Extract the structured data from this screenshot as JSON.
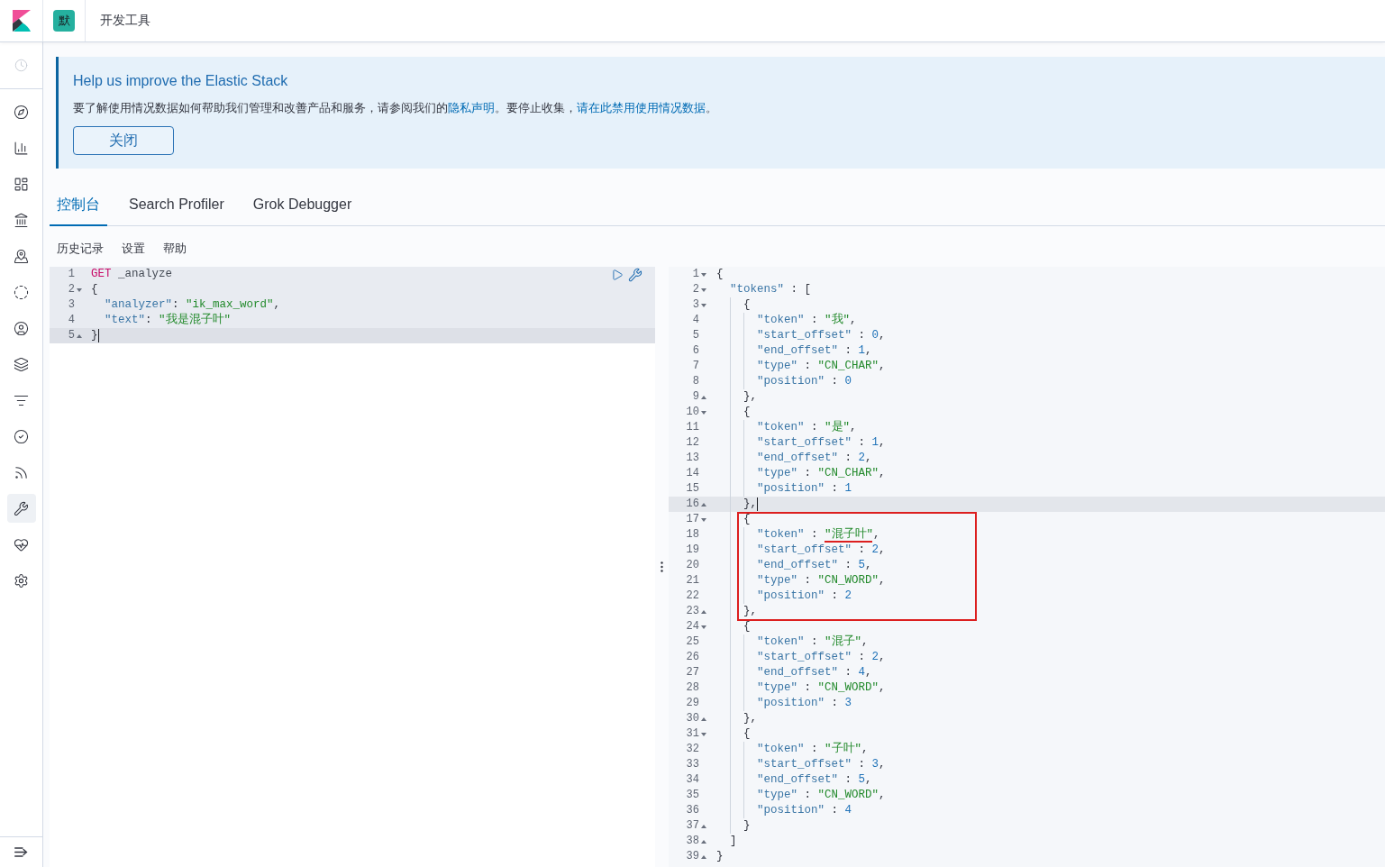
{
  "header": {
    "space_initial": "默",
    "title": "开发工具"
  },
  "sidebar": {
    "items": [
      {
        "kind": "compass",
        "selected": false
      },
      {
        "kind": "bar-chart",
        "selected": false
      },
      {
        "kind": "dashboard",
        "selected": false
      },
      {
        "kind": "building",
        "selected": false
      },
      {
        "kind": "map-pin",
        "selected": false
      },
      {
        "kind": "dashed-circle",
        "selected": false
      },
      {
        "kind": "user-circle",
        "selected": false
      },
      {
        "kind": "layers",
        "selected": false
      },
      {
        "kind": "filter",
        "selected": false
      },
      {
        "kind": "check-circle",
        "selected": false
      },
      {
        "kind": "signal",
        "selected": false
      },
      {
        "kind": "wrench",
        "selected": true
      },
      {
        "kind": "heart-pulse",
        "selected": false
      },
      {
        "kind": "gear",
        "selected": false
      }
    ]
  },
  "notice": {
    "title": "Help us improve the Elastic Stack",
    "body": [
      {
        "kind": "text",
        "text": "要了解使用情况数据如何帮助我们管理和改善产品和服务，请参阅我们的"
      },
      {
        "kind": "link",
        "text": "隐私声明"
      },
      {
        "kind": "text",
        "text": "。要停止收集，"
      },
      {
        "kind": "link",
        "text": "请在此禁用使用情况数据"
      },
      {
        "kind": "text",
        "text": "。"
      }
    ],
    "button": "关闭"
  },
  "tabs": [
    {
      "label": "控制台",
      "selected": true
    },
    {
      "label": "Search Profiler",
      "selected": false
    },
    {
      "label": "Grok Debugger",
      "selected": false
    }
  ],
  "toolbar": [
    "历史记录",
    "设置",
    "帮助"
  ],
  "request_editor": {
    "request_selected": true,
    "lines": [
      {
        "number": "1",
        "kind": "plain",
        "code": "GET _analyze",
        "active": false
      },
      {
        "number": "2",
        "kind": "fold-start",
        "code": "{",
        "active": false
      },
      {
        "number": "3",
        "kind": "plain",
        "code": "  \"analyzer\": \"ik_max_word\",",
        "active": false
      },
      {
        "number": "4",
        "kind": "plain",
        "code": "  \"text\": \"我是混子叶\"",
        "active": false
      },
      {
        "number": "5",
        "kind": "fold-end",
        "code": "}",
        "active": true
      }
    ]
  },
  "response_viewer": {
    "blocks": [
      {
        "kind": "plain",
        "lines": [
          {
            "number": "1",
            "kind": "fold-start",
            "code": "{",
            "active": false,
            "underlined": false
          },
          {
            "number": "2",
            "kind": "fold-start",
            "code": "  \"tokens\" : [",
            "active": false,
            "underlined": false
          },
          {
            "number": "3",
            "kind": "fold-start",
            "code": "    {",
            "active": false,
            "underlined": false
          },
          {
            "number": "4",
            "kind": "plain",
            "code": "      \"token\" : \"我\",",
            "active": false,
            "underlined": false
          },
          {
            "number": "5",
            "kind": "plain",
            "code": "      \"start_offset\" : 0,",
            "active": false,
            "underlined": false
          },
          {
            "number": "6",
            "kind": "plain",
            "code": "      \"end_offset\" : 1,",
            "active": false,
            "underlined": false
          },
          {
            "number": "7",
            "kind": "plain",
            "code": "      \"type\" : \"CN_CHAR\",",
            "active": false,
            "underlined": false
          },
          {
            "number": "8",
            "kind": "plain",
            "code": "      \"position\" : 0",
            "active": false,
            "underlined": false
          },
          {
            "number": "9",
            "kind": "fold-end",
            "code": "    },",
            "active": false,
            "underlined": false
          },
          {
            "number": "10",
            "kind": "fold-start",
            "code": "    {",
            "active": false,
            "underlined": false
          },
          {
            "number": "11",
            "kind": "plain",
            "code": "      \"token\" : \"是\",",
            "active": false,
            "underlined": false
          },
          {
            "number": "12",
            "kind": "plain",
            "code": "      \"start_offset\" : 1,",
            "active": false,
            "underlined": false
          },
          {
            "number": "13",
            "kind": "plain",
            "code": "      \"end_offset\" : 2,",
            "active": false,
            "underlined": false
          },
          {
            "number": "14",
            "kind": "plain",
            "code": "      \"type\" : \"CN_CHAR\",",
            "active": false,
            "underlined": false
          },
          {
            "number": "15",
            "kind": "plain",
            "code": "      \"position\" : 1",
            "active": false,
            "underlined": false
          },
          {
            "number": "16",
            "kind": "fold-end",
            "code": "    },",
            "active": true,
            "underlined": false
          }
        ]
      },
      {
        "kind": "boxed",
        "lines": [
          {
            "number": "17",
            "kind": "fold-start",
            "code": "    {",
            "active": false,
            "underlined": false
          },
          {
            "number": "18",
            "kind": "plain",
            "code": "      \"token\" : \"混子叶\",",
            "active": false,
            "underlined": true
          },
          {
            "number": "19",
            "kind": "plain",
            "code": "      \"start_offset\" : 2,",
            "active": false,
            "underlined": false
          },
          {
            "number": "20",
            "kind": "plain",
            "code": "      \"end_offset\" : 5,",
            "active": false,
            "underlined": false
          },
          {
            "number": "21",
            "kind": "plain",
            "code": "      \"type\" : \"CN_WORD\",",
            "active": false,
            "underlined": false
          },
          {
            "number": "22",
            "kind": "plain",
            "code": "      \"position\" : 2",
            "active": false,
            "underlined": false
          },
          {
            "number": "23",
            "kind": "fold-end",
            "code": "    },",
            "active": false,
            "underlined": false
          }
        ]
      },
      {
        "kind": "plain",
        "lines": [
          {
            "number": "24",
            "kind": "fold-start",
            "code": "    {",
            "active": false,
            "underlined": false
          },
          {
            "number": "25",
            "kind": "plain",
            "code": "      \"token\" : \"混子\",",
            "active": false,
            "underlined": false
          },
          {
            "number": "26",
            "kind": "plain",
            "code": "      \"start_offset\" : 2,",
            "active": false,
            "underlined": false
          },
          {
            "number": "27",
            "kind": "plain",
            "code": "      \"end_offset\" : 4,",
            "active": false,
            "underlined": false
          },
          {
            "number": "28",
            "kind": "plain",
            "code": "      \"type\" : \"CN_WORD\",",
            "active": false,
            "underlined": false
          },
          {
            "number": "29",
            "kind": "plain",
            "code": "      \"position\" : 3",
            "active": false,
            "underlined": false
          },
          {
            "number": "30",
            "kind": "fold-end",
            "code": "    },",
            "active": false,
            "underlined": false
          },
          {
            "number": "31",
            "kind": "fold-start",
            "code": "    {",
            "active": false,
            "underlined": false
          },
          {
            "number": "32",
            "kind": "plain",
            "code": "      \"token\" : \"子叶\",",
            "active": false,
            "underlined": false
          },
          {
            "number": "33",
            "kind": "plain",
            "code": "      \"start_offset\" : 3,",
            "active": false,
            "underlined": false
          },
          {
            "number": "34",
            "kind": "plain",
            "code": "      \"end_offset\" : 5,",
            "active": false,
            "underlined": false
          },
          {
            "number": "35",
            "kind": "plain",
            "code": "      \"type\" : \"CN_WORD\",",
            "active": false,
            "underlined": false
          },
          {
            "number": "36",
            "kind": "plain",
            "code": "      \"position\" : 4",
            "active": false,
            "underlined": false
          },
          {
            "number": "37",
            "kind": "fold-end",
            "code": "    }",
            "active": false,
            "underlined": false
          },
          {
            "number": "38",
            "kind": "fold-end",
            "code": "  ]",
            "active": false,
            "underlined": false
          },
          {
            "number": "39",
            "kind": "fold-end",
            "code": "}",
            "active": false,
            "underlined": false
          }
        ]
      }
    ]
  }
}
